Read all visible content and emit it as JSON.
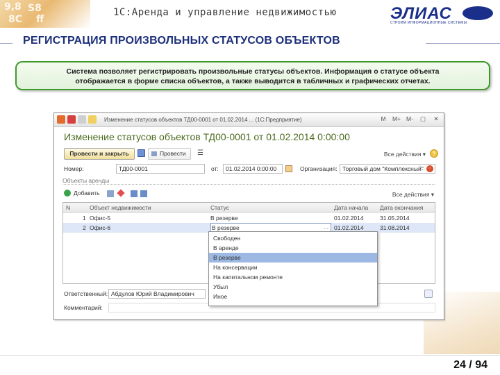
{
  "slide": {
    "header_deco": [
      "9,8",
      "S8",
      "8C",
      "ff"
    ],
    "app_title": "1С:Аренда и управление недвижимостью",
    "logo_text": "ЭЛИАС",
    "logo_subtitle": "СТРОИМ ИНФОРМАЦИОННЫЕ СИСТЕМЫ",
    "title": "РЕГИСТРАЦИЯ ПРОИЗВОЛЬНЫХ СТАТУСОВ ОБЪЕКТОВ",
    "description_line1": "Система позволяет регистрировать произвольные статусы объектов. Информация о статусе объекта",
    "description_line2": "отображается в форме списка объектов, а также выводится в табличных и графических отчетах.",
    "page": "24 / 94"
  },
  "window": {
    "title": "Изменение статусов объектов ТД00-0001 от 01.02.2014 ... (1С:Предприятие)",
    "controls": [
      "M",
      "M+",
      "M-",
      "▢",
      "✕"
    ],
    "form_title": "Изменение статусов объектов ТД00-0001 от 01.02.2014 0:00:00",
    "toolbar": {
      "post_close_label": "Провести и закрыть",
      "post_label": "Провести",
      "print_label": "☰",
      "all_actions": "Все действия ▾",
      "help": "?"
    },
    "header": {
      "number_label": "Номер:",
      "number_value": "ТД00-0001",
      "from_label": "от:",
      "date_value": "01.02.2014 0:00:00",
      "org_label": "Организация:",
      "org_value": "Торговый дом \"Комплексный\""
    },
    "section_label": "Объекты аренды",
    "tab_toolbar": {
      "add_label": "Добавить",
      "all_actions": "Все действия ▾"
    },
    "table": {
      "columns": [
        "N",
        "Объект недвижимости",
        "Статус",
        "Дата начала",
        "Дата окончания"
      ],
      "rows": [
        {
          "n": "1",
          "object": "Офис-5",
          "status": "В резерве",
          "start": "01.02.2014",
          "end": "31.05.2014"
        },
        {
          "n": "2",
          "object": "Офис-6",
          "status": "В резерве",
          "start": "01.02.2014",
          "end": "31.08.2014"
        }
      ]
    },
    "dropdown": {
      "items": [
        "Свободен",
        "В аренде",
        "В резерве",
        "На консервации",
        "На капитальном ремонте",
        "Убыл",
        "Иное"
      ],
      "selected_index": 2
    },
    "footer": {
      "responsible_label": "Ответственный:",
      "responsible_value": "Абдулов Юрий Владимирович",
      "comment_label": "Комментарий:"
    }
  },
  "colors": {
    "title_blue": "#1c2f7a",
    "form_title_green": "#4b6b1f",
    "desc_border_green": "#3e9a2c",
    "selected_row": "#dde7f7",
    "dropdown_selected": "#9db8e2"
  }
}
